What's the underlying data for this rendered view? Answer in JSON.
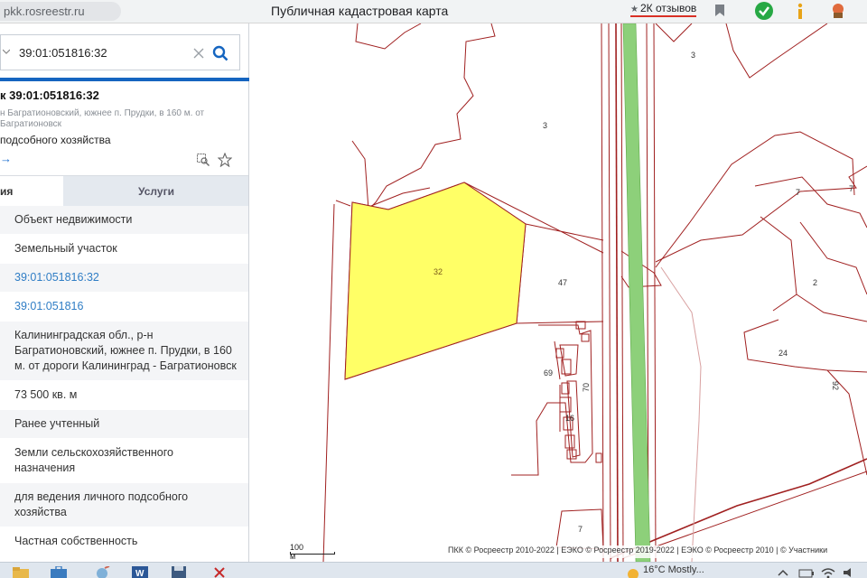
{
  "browser": {
    "url": "pkk.rosreestr.ru",
    "title": "Публичная кадастровая карта",
    "reviews": "2К отзывов"
  },
  "sidebar": {
    "search": {
      "value": "39:01:051816:32"
    },
    "object": {
      "title": "к 39:01:051816:32",
      "address": "н Багратионовский, южнее п. Прудки, в 160 м. от Багратионовск",
      "use": "подсобного хозяйства",
      "arrow": "→"
    },
    "tabs": {
      "info": "ия",
      "services": "Услуги"
    },
    "rows": [
      {
        "text": "Объект недвижимости",
        "kind": "plain"
      },
      {
        "text": "Земельный участок",
        "kind": "plain"
      },
      {
        "text": "39:01:051816:32",
        "kind": "link"
      },
      {
        "text": "39:01:051816",
        "kind": "link"
      },
      {
        "text": "Калининградская обл., р-н Багратионовский, южнее п. Прудки, в 160 м. от дороги Калининград - Багратионовск",
        "kind": "plain"
      },
      {
        "text": "73 500 кв. м",
        "kind": "plain"
      },
      {
        "text": "Ранее учтенный",
        "kind": "plain"
      },
      {
        "text": "Земли сельскохозяйственного назначения",
        "kind": "plain"
      },
      {
        "text": "для ведения личного подсобного хозяйства",
        "kind": "plain"
      },
      {
        "text": "Частная собственность",
        "kind": "plain"
      }
    ]
  },
  "map": {
    "labels": {
      "l3a": "3",
      "l3b": "3",
      "l7a": "7",
      "l7b": "7",
      "l32": "32",
      "l47": "47",
      "l2": "2",
      "l24": "24",
      "l69": "69",
      "l70": "70",
      "l16": "16",
      "l92": "92",
      "l7c": "7"
    },
    "scale": "100 м",
    "copyright": "ПКК © Росреестр 2010-2022 | ЕЭКО © Росреестр 2019-2022 | ЕЭКО © Росреестр 2010 | © Участники",
    "colors": {
      "parcel": "#ffff66",
      "road": "#8dd07a",
      "boundary": "#a02020"
    }
  },
  "taskbar": {
    "weather": "16°C  Mostly..."
  }
}
